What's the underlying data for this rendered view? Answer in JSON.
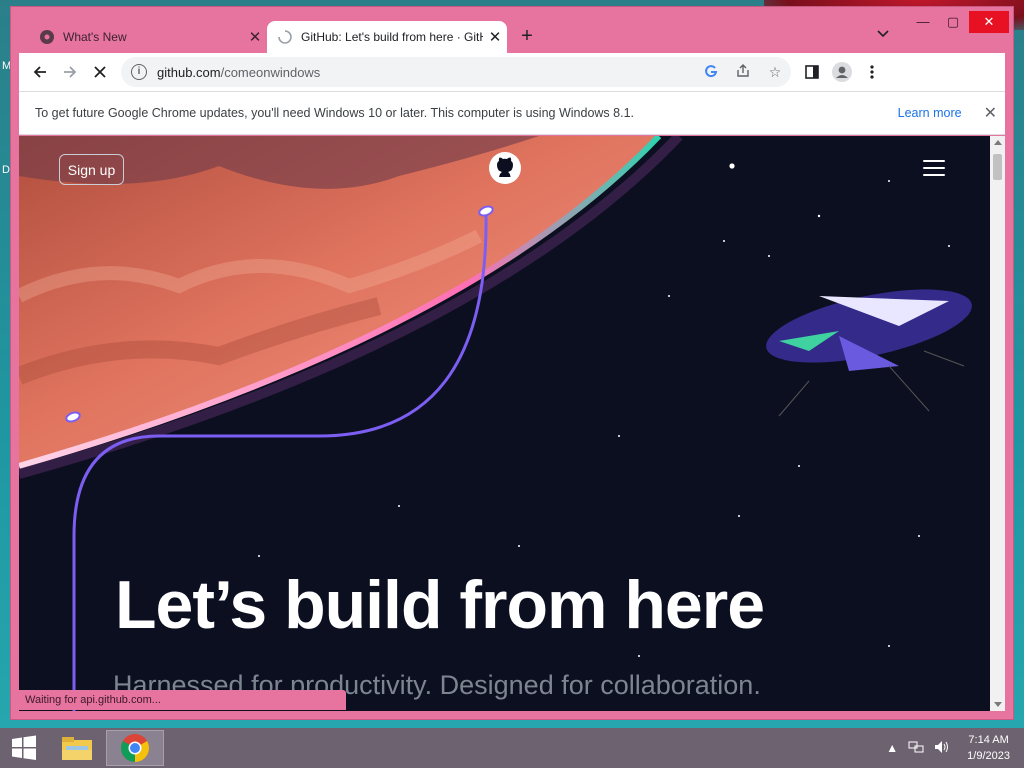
{
  "desktop": {
    "edge_letters": [
      "M",
      "D"
    ]
  },
  "browser": {
    "tabs": [
      {
        "title": "What's New",
        "active": false
      },
      {
        "title": "GitHub: Let's build from here · GitHub",
        "active": true
      }
    ],
    "address": {
      "host": "github.com",
      "path": "/comeonwindows"
    },
    "infobar": {
      "message": "To get future Google Chrome updates, you'll need Windows 10 or later. This computer is using Windows 8.1.",
      "link": "Learn more"
    },
    "status_text": "Waiting for api.github.com..."
  },
  "page": {
    "signup_label": "Sign up",
    "hero_title": "Let’s build from here",
    "hero_subtitle": "Harnessed for productivity. Designed for collaboration."
  },
  "taskbar": {
    "time": "7:14 AM",
    "date": "1/9/2023"
  },
  "colors": {
    "window_frame": "#e7739f",
    "page_bg": "#0d1021",
    "accent_link": "#1a73e8",
    "planet": "#e0685c",
    "trail": "#7c5ff2"
  }
}
